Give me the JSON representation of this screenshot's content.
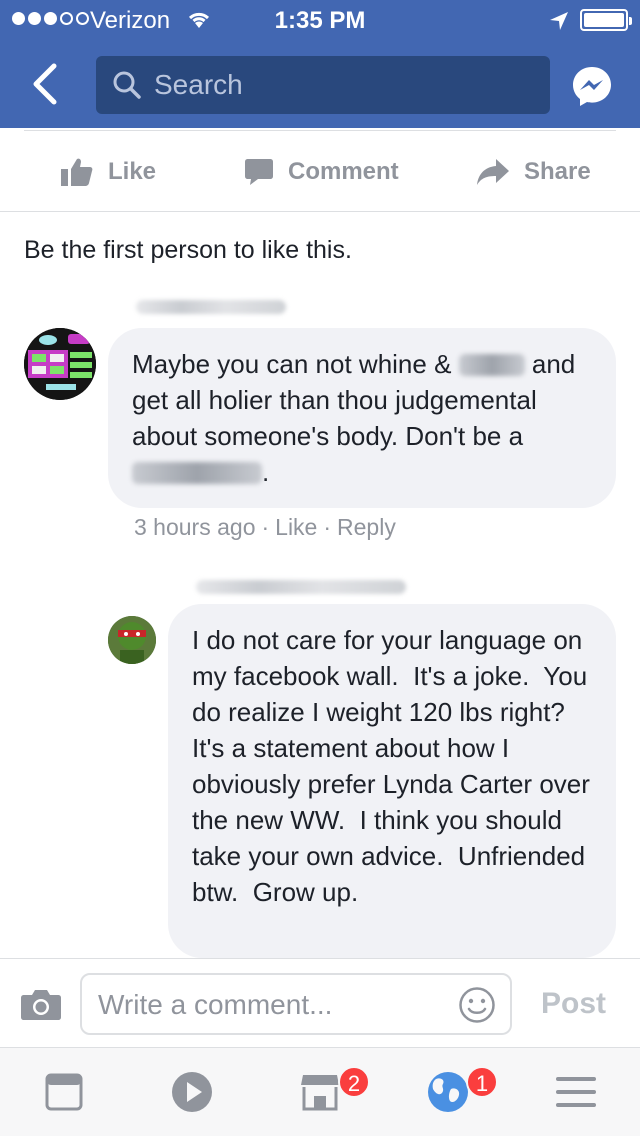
{
  "status_bar": {
    "carrier": "Verizon",
    "time": "1:35 PM",
    "signal_bars_filled": 3,
    "signal_bars_total": 5
  },
  "nav": {
    "back_icon": "chevron-left-icon",
    "search_placeholder": "Search",
    "messenger_icon": "messenger-icon"
  },
  "actions": {
    "like": "Like",
    "comment": "Comment",
    "share": "Share"
  },
  "likes_text": "Be the first person to like this.",
  "comments": [
    {
      "text_before": "Maybe you can not whine &",
      "text_middle": "and get all holier than thou judgemental about someone's body. Don't be a",
      "text_end": ".",
      "time": "3 hours ago",
      "like": "Like",
      "reply": "Reply"
    },
    {
      "text": "I do not care for your language on my facebook wall.  It's a joke.  You do realize I weight 120 lbs right?  It's a statement about how I obviously prefer Lynda Carter over the new WW.  I think you should take your own advice.  Unfriended btw.  Grow up."
    }
  ],
  "composer": {
    "placeholder": "Write a comment...",
    "post_label": "Post"
  },
  "tabbar": {
    "marketplace_badge": "2",
    "notifications_badge": "1"
  },
  "colors": {
    "brand_blue": "#4267b2",
    "search_bg": "#29487d",
    "bubble_bg": "#f1f2f6",
    "muted": "#90949c",
    "badge_red": "#fa3e3e"
  }
}
